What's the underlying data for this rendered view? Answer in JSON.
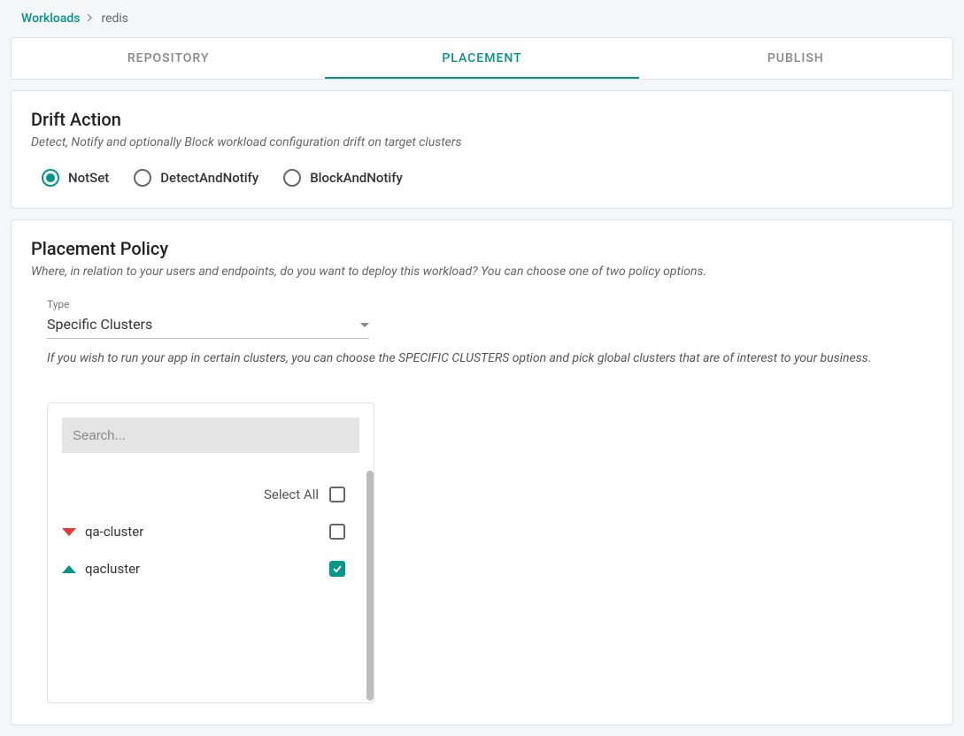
{
  "breadcrumb": {
    "root": "Workloads",
    "current": "redis"
  },
  "tabs": [
    {
      "label": "REPOSITORY",
      "active": false
    },
    {
      "label": "PLACEMENT",
      "active": true
    },
    {
      "label": "PUBLISH",
      "active": false
    }
  ],
  "drift": {
    "title": "Drift Action",
    "subtitle": "Detect, Notify and optionally Block workload configuration drift on target clusters",
    "options": [
      {
        "label": "NotSet",
        "selected": true
      },
      {
        "label": "DetectAndNotify",
        "selected": false
      },
      {
        "label": "BlockAndNotify",
        "selected": false
      }
    ]
  },
  "placement": {
    "title": "Placement Policy",
    "subtitle": "Where, in relation to your users and endpoints, do you want to deploy this workload? You can choose one of two policy options.",
    "typeLabel": "Type",
    "typeValue": "Specific Clusters",
    "hint": "If you wish to run your app in certain clusters, you can choose the SPECIFIC CLUSTERS option and pick global clusters that are of interest to your business.",
    "searchPlaceholder": "Search...",
    "selectAllLabel": "Select All",
    "clusters": [
      {
        "name": "qa-cluster",
        "status": "down",
        "checked": false
      },
      {
        "name": "qacluster",
        "status": "up",
        "checked": true
      }
    ]
  }
}
